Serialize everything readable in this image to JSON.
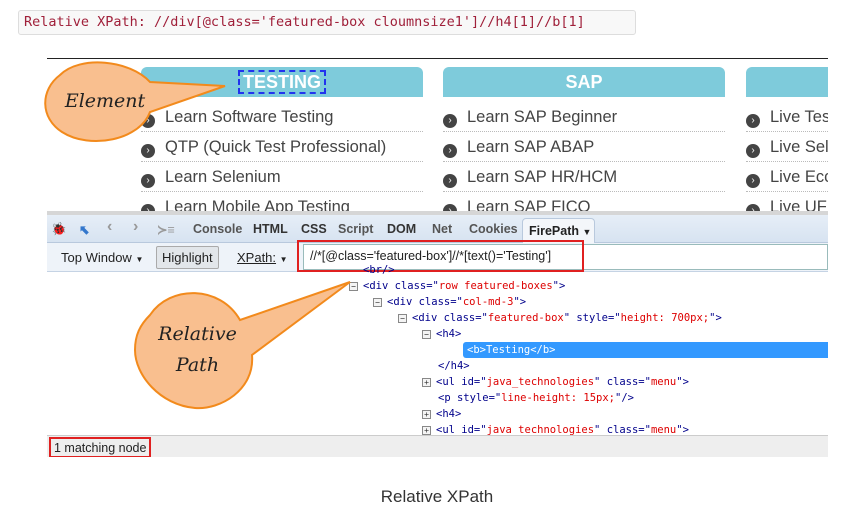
{
  "code_box": "Relative XPath: //div[@class='featured-box cloumnsize1']//h4[1]//b[1]",
  "columns": [
    {
      "header": "TESTING",
      "items": [
        "Learn Software Testing",
        "QTP (Quick Test Professional)",
        "Learn Selenium",
        "Learn Mobile App Testing"
      ]
    },
    {
      "header": "SAP",
      "items": [
        "Learn SAP Beginner",
        "Learn SAP ABAP",
        "Learn SAP HR/HCM",
        "Learn SAP FICO"
      ]
    },
    {
      "header": "",
      "items": [
        "Live Tes",
        "Live Sel",
        "Live Ecc",
        "Live UF"
      ]
    }
  ],
  "firebug": {
    "tabs": [
      "Console",
      "HTML",
      "CSS",
      "Script",
      "DOM",
      "Net",
      "Cookies",
      "FirePath"
    ],
    "active_tab": "FirePath",
    "toolbar": {
      "window": "Top Window",
      "highlight": "Highlight",
      "xpath_label": "XPath:",
      "xpath_value": "//*[@class='featured-box']//*[text()='Testing']"
    },
    "tree": [
      {
        "tag": "<br/>"
      },
      {
        "pre": "<div class=\"",
        "val": "row featured-boxes",
        "post": "\">"
      },
      {
        "pre": "<div class=\"",
        "val": "col-md-3",
        "post": "\">"
      },
      {
        "pre": "<div class=\"",
        "val": "featured-box",
        "mid": "\" style=\"",
        "val2": "height: 700px;",
        "post": "\">"
      },
      {
        "tag": "<h4>"
      },
      {
        "tag": "<b>Testing</b>"
      },
      {
        "tag": "</h4>"
      },
      {
        "pre": "<ul id=\"",
        "val": "java_technologies",
        "mid": "\" class=\"",
        "val2": "menu",
        "post": "\">"
      },
      {
        "pre": "<p style=\"",
        "val": "line-height: 15px;",
        "post": "\"/>"
      },
      {
        "tag": "<h4>"
      },
      {
        "pre": "<ul id=\"",
        "val": "java_technologies",
        "mid": "\" class=\"",
        "val2": "menu",
        "post": "\">"
      }
    ],
    "status": "1 matching node"
  },
  "callouts": {
    "element": "Element",
    "relative_path_1": "Relative",
    "relative_path_2": "Path"
  },
  "caption": "Relative XPath",
  "colors": {
    "header": "#7ecbdb",
    "callout": "#f9bf8f",
    "callout_border": "#f28a1c",
    "highlight": "#3399ff",
    "annotation_box": "#e02020"
  }
}
